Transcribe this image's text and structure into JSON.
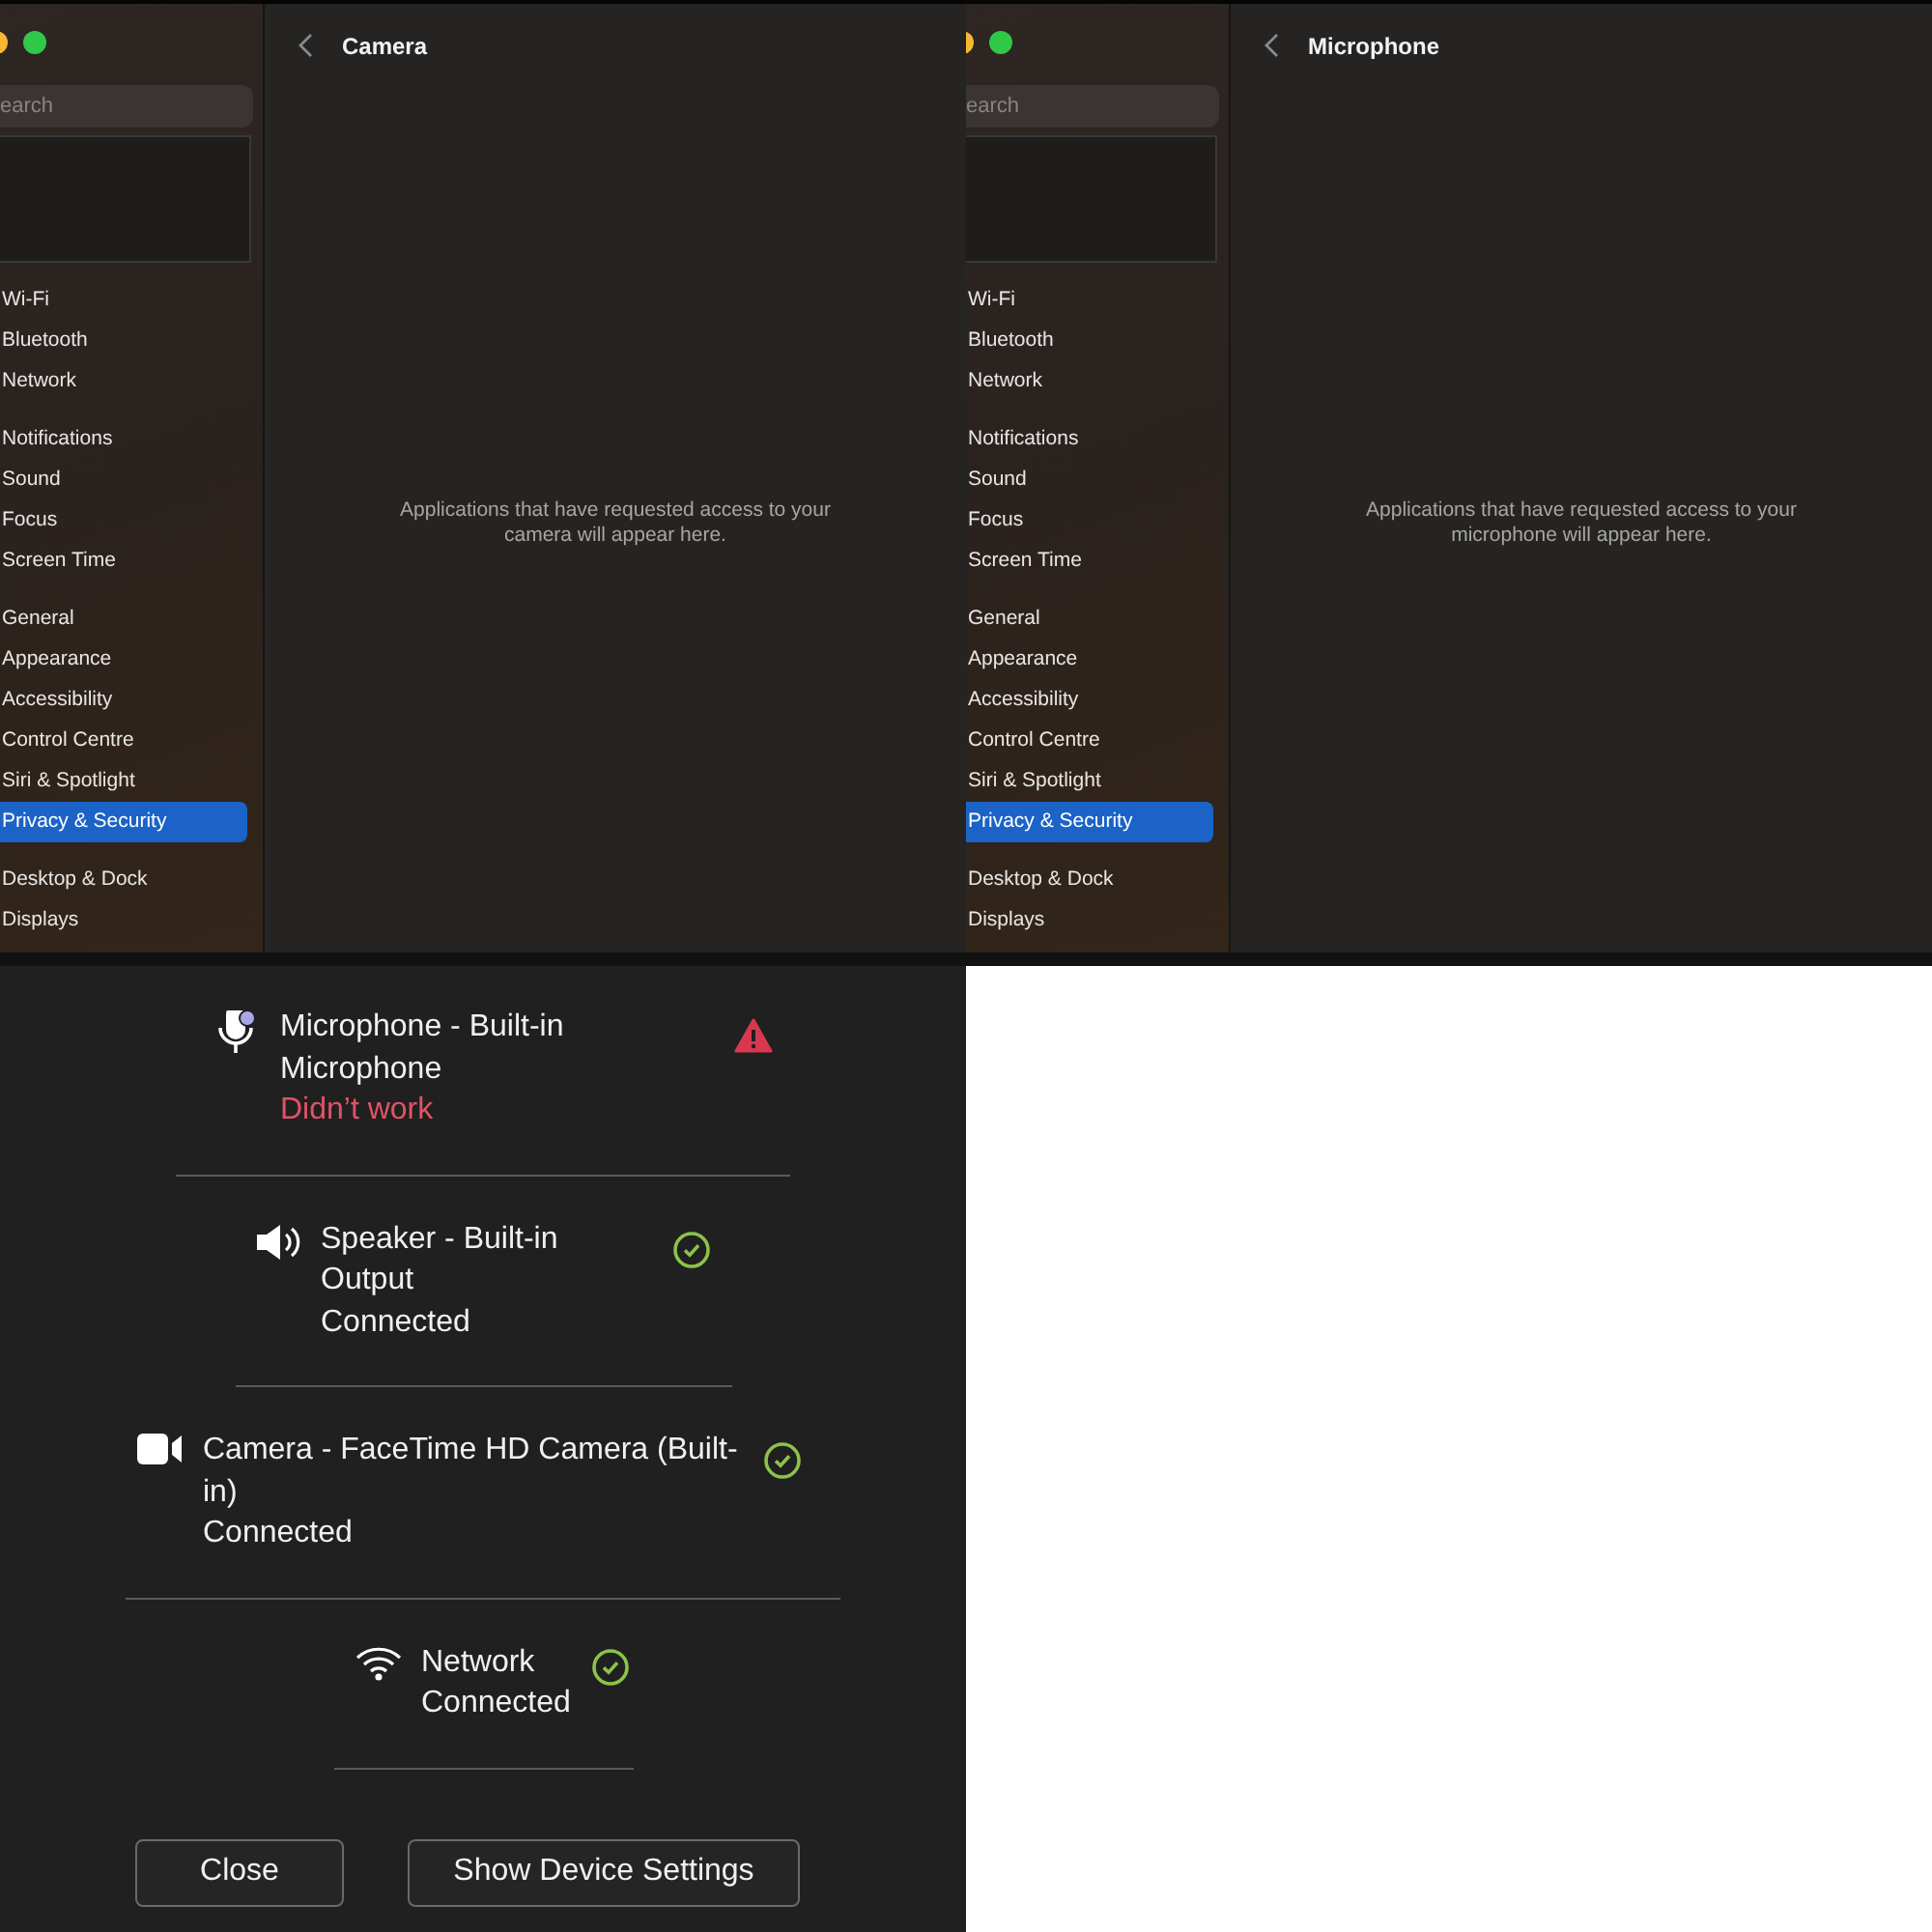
{
  "settings_windows": [
    {
      "search": {
        "placeholder": "earch"
      },
      "sidebar": {
        "groups": [
          [
            {
              "label": "Wi-Fi",
              "selected": false
            },
            {
              "label": "Bluetooth",
              "selected": false
            },
            {
              "label": "Network",
              "selected": false
            }
          ],
          [
            {
              "label": "Notifications",
              "selected": false
            },
            {
              "label": "Sound",
              "selected": false
            },
            {
              "label": "Focus",
              "selected": false
            },
            {
              "label": "Screen Time",
              "selected": false
            }
          ],
          [
            {
              "label": "General",
              "selected": false
            },
            {
              "label": "Appearance",
              "selected": false
            },
            {
              "label": "Accessibility",
              "selected": false
            },
            {
              "label": "Control Centre",
              "selected": false
            },
            {
              "label": "Siri & Spotlight",
              "selected": false
            },
            {
              "label": "Privacy & Security",
              "selected": true
            }
          ],
          [
            {
              "label": "Desktop & Dock",
              "selected": false
            },
            {
              "label": "Displays",
              "selected": false
            }
          ]
        ]
      },
      "title": "Camera",
      "empty_message": "Applications that have requested access to your camera will appear here."
    },
    {
      "search": {
        "placeholder": "earch"
      },
      "sidebar": {
        "groups": [
          [
            {
              "label": "Wi-Fi",
              "selected": false
            },
            {
              "label": "Bluetooth",
              "selected": false
            },
            {
              "label": "Network",
              "selected": false
            }
          ],
          [
            {
              "label": "Notifications",
              "selected": false
            },
            {
              "label": "Sound",
              "selected": false
            },
            {
              "label": "Focus",
              "selected": false
            },
            {
              "label": "Screen Time",
              "selected": false
            }
          ],
          [
            {
              "label": "General",
              "selected": false
            },
            {
              "label": "Appearance",
              "selected": false
            },
            {
              "label": "Accessibility",
              "selected": false
            },
            {
              "label": "Control Centre",
              "selected": false
            },
            {
              "label": "Siri & Spotlight",
              "selected": false
            },
            {
              "label": "Privacy & Security",
              "selected": true
            }
          ],
          [
            {
              "label": "Desktop & Dock",
              "selected": false
            },
            {
              "label": "Displays",
              "selected": false
            }
          ]
        ]
      },
      "title": "Microphone",
      "empty_message": "Applications that have requested access to your microphone will appear here."
    }
  ],
  "device_dialog": {
    "devices": [
      {
        "kind": "microphone",
        "name": "Microphone - Built-in Microphone",
        "status": "Didn’t work",
        "failed": true
      },
      {
        "kind": "speaker",
        "name": "Speaker - Built-in Output",
        "status": "Connected",
        "failed": false
      },
      {
        "kind": "camera",
        "name": "Camera - FaceTime HD Camera (Built-in)",
        "status": "Connected",
        "failed": false
      },
      {
        "kind": "network",
        "name": "Network",
        "status": "Connected",
        "failed": false
      }
    ],
    "buttons": [
      "Close",
      "Show Device Settings"
    ]
  }
}
